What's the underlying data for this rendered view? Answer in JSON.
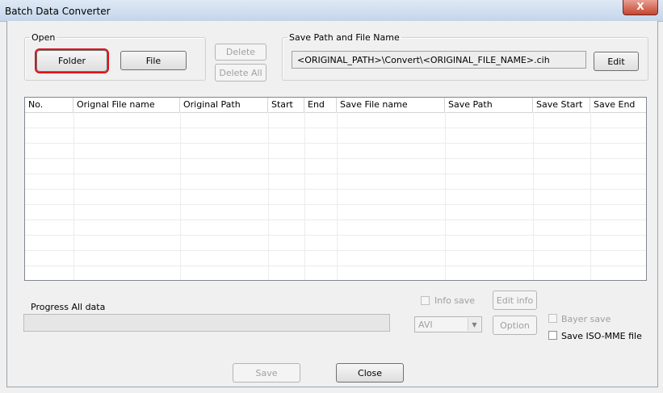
{
  "window": {
    "title": "Batch Data Converter",
    "close_glyph": "X"
  },
  "open_group": {
    "legend": "Open",
    "folder_label": "Folder",
    "file_label": "File"
  },
  "list_actions": {
    "delete_label": "Delete",
    "delete_all_label": "Delete All"
  },
  "save_group": {
    "legend": "Save Path and File Name",
    "path_value": "<ORIGINAL_PATH>\\Convert\\<ORIGINAL_FILE_NAME>.cih",
    "edit_label": "Edit"
  },
  "table": {
    "columns": [
      "No.",
      "Orignal File name",
      "Original Path",
      "Start",
      "End",
      "Save File name",
      "Save Path",
      "Save Start",
      "Save End"
    ],
    "rows": []
  },
  "progress": {
    "label": "Progress All data",
    "value": 0
  },
  "options": {
    "info_save_label": "Info save",
    "info_save_checked": false,
    "edit_info_label": "Edit info",
    "format_value": "AVI",
    "option_label": "Option",
    "bayer_save_label": "Bayer save",
    "bayer_save_checked": false,
    "iso_mme_label": "Save ISO-MME file",
    "iso_mme_checked": false
  },
  "footer": {
    "save_label": "Save",
    "close_label": "Close"
  },
  "icons": {
    "dropdown": "chevron-down-icon"
  },
  "colors": {
    "focus_highlight": "#e0141b",
    "close_button": "#c7452f"
  }
}
